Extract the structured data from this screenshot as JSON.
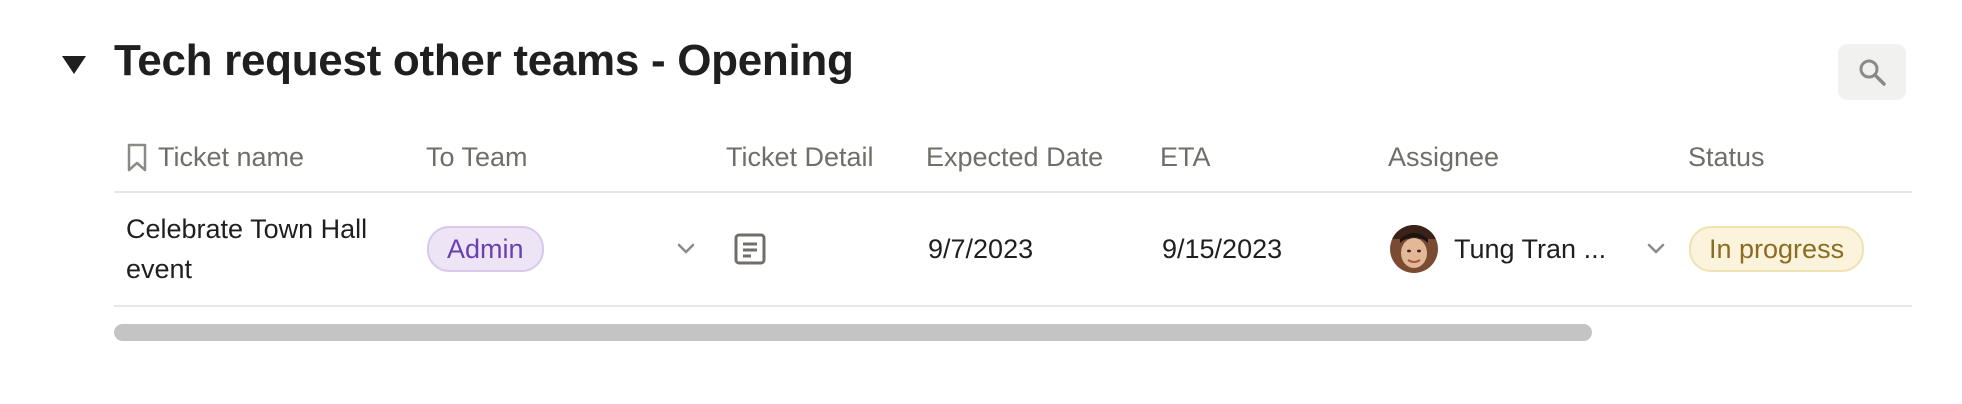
{
  "header": {
    "title": "Tech request other teams - Opening",
    "toggle_icon": "triangle-down-icon",
    "search_icon": "search-icon"
  },
  "table": {
    "columns": [
      {
        "key": "ticket_name",
        "label": "Ticket name",
        "icon": "bookmark-icon"
      },
      {
        "key": "to_team",
        "label": "To Team"
      },
      {
        "key": "ticket_detail",
        "label": "Ticket Detail"
      },
      {
        "key": "expected_date",
        "label": "Expected Date"
      },
      {
        "key": "eta",
        "label": "ETA"
      },
      {
        "key": "assignee",
        "label": "Assignee"
      },
      {
        "key": "status",
        "label": "Status"
      }
    ],
    "rows": [
      {
        "ticket_name": "Celebrate Town Hall event",
        "to_team": "Admin",
        "ticket_detail_icon": "document-icon",
        "expected_date": "9/7/2023",
        "eta": "9/15/2023",
        "assignee": "Tung Tran ...",
        "status": "In progress"
      }
    ]
  },
  "colors": {
    "admin_tag_bg": "#ede4f5",
    "admin_tag_text": "#6a3fb0",
    "status_tag_bg": "#fbf3db",
    "status_tag_text": "#8a6d22"
  }
}
